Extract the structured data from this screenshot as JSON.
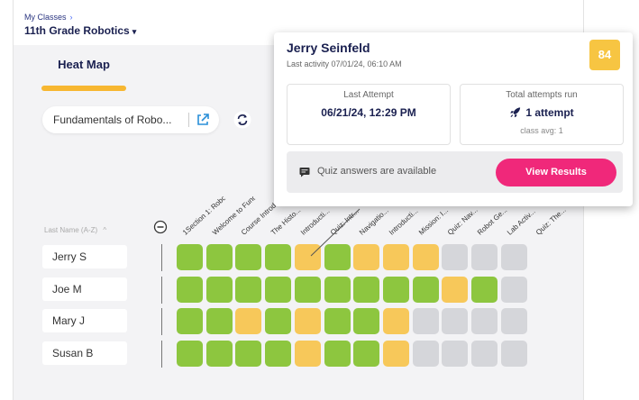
{
  "breadcrumb": {
    "parent": "My Classes",
    "separator": "›"
  },
  "class_selector": {
    "title": "11th Grade Robotics",
    "caret": "▾"
  },
  "tabs": {
    "heat_map": "Heat Map"
  },
  "module_selector": {
    "label": "Fundamentals of Robo..."
  },
  "table": {
    "sort_label": "Last Name (A-Z)",
    "sort_arrow": "^",
    "columns": [
      "1Section 1: Robot S...",
      "Welcome to Funda...",
      "Course Introductio...",
      "The Histo...",
      "Introducti...",
      "Quiz: Intr...",
      "Navigatio...",
      "Introducti...",
      "Mission: I...",
      "Quiz: Nav...",
      "Robot Ge...",
      "Lab Activ...",
      "Quiz: The..."
    ],
    "students": [
      {
        "name": "Jerry S",
        "cells": [
          "g",
          "g",
          "g",
          "g",
          "y",
          "g",
          "y",
          "y",
          "y",
          "n",
          "n",
          "n"
        ]
      },
      {
        "name": "Joe M",
        "cells": [
          "g",
          "g",
          "g",
          "g",
          "g",
          "g",
          "g",
          "g",
          "g",
          "y",
          "g",
          "n"
        ]
      },
      {
        "name": "Mary J",
        "cells": [
          "g",
          "g",
          "y",
          "g",
          "y",
          "g",
          "g",
          "y",
          "n",
          "n",
          "n",
          "n"
        ]
      },
      {
        "name": "Susan B",
        "cells": [
          "g",
          "g",
          "g",
          "g",
          "y",
          "g",
          "g",
          "y",
          "n",
          "n",
          "n",
          "n"
        ]
      }
    ]
  },
  "colors": {
    "g": "#8dc63f",
    "y": "#f7c85a",
    "n": "#d5d6da",
    "accent": "#f0287a",
    "tab_underline": "#f7b731"
  },
  "popup": {
    "student_name": "Jerry Seinfeld",
    "last_activity": "Last activity 07/01/24, 06:10 AM",
    "score": "84",
    "last_attempt_label": "Last Attempt",
    "last_attempt_value": "06/21/24, 12:29 PM",
    "total_label": "Total attempts run",
    "total_value": "1 attempt",
    "class_avg": "class avg: 1",
    "quiz_text": "Quiz answers are available",
    "view_button": "View Results"
  }
}
